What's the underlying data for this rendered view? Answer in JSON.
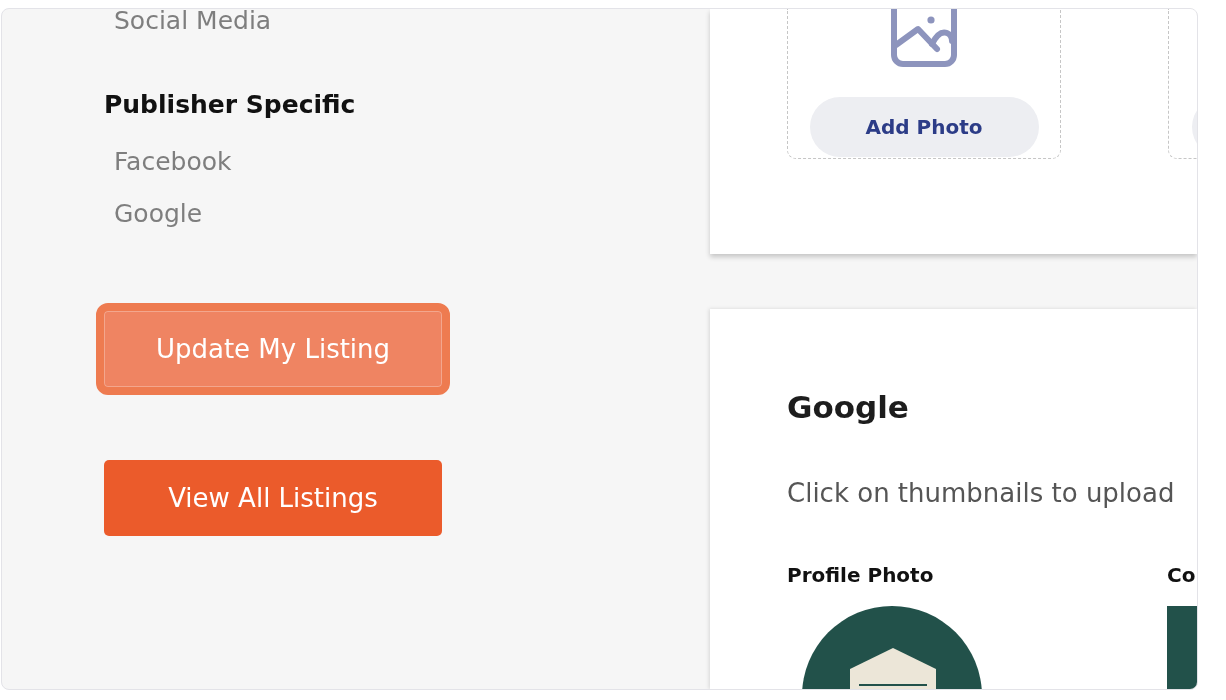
{
  "sidebar": {
    "items": [
      {
        "label": "Social Media"
      }
    ],
    "section": {
      "title": "Publisher Specific",
      "items": [
        {
          "label": "Facebook"
        },
        {
          "label": "Google"
        }
      ]
    },
    "buttons": [
      {
        "label": "Update My Listing",
        "focused": true
      },
      {
        "label": "View All Listings",
        "focused": false
      }
    ]
  },
  "photo_card": {
    "tiles": [
      {
        "kind": "full",
        "button": "Add Photo"
      },
      {
        "kind": "partial"
      }
    ]
  },
  "google_card": {
    "title": "Google",
    "description": "Click on thumbnails to upload",
    "photos": [
      {
        "label": "Profile Photo",
        "kind": "profile"
      },
      {
        "label": "Co",
        "kind": "cover"
      }
    ]
  }
}
